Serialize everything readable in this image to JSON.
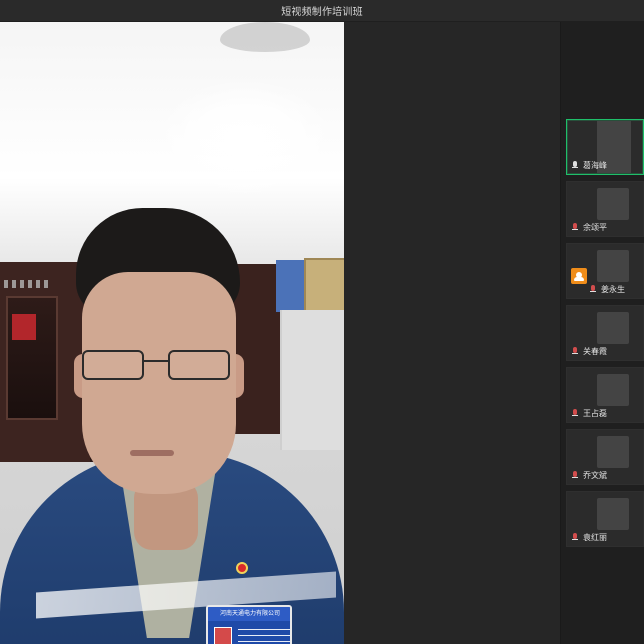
{
  "window": {
    "title": "短视频制作培训班"
  },
  "main_video": {
    "badge": {
      "company_text": "河南天通电力有限公司"
    }
  },
  "participants": [
    {
      "name": "葛海峰",
      "active": true,
      "avatar": "av-1",
      "host": false
    },
    {
      "name": "余颂平",
      "active": false,
      "avatar": "av-2",
      "host": false
    },
    {
      "name": "姜永生",
      "active": false,
      "avatar": "av-3",
      "host": true
    },
    {
      "name": "关春霞",
      "active": false,
      "avatar": "av-4",
      "host": false
    },
    {
      "name": "王占磊",
      "active": false,
      "avatar": "av-5",
      "host": false
    },
    {
      "name": "乔文斌",
      "active": false,
      "avatar": "av-6",
      "host": false
    },
    {
      "name": "袁红丽",
      "active": false,
      "avatar": "av-7",
      "host": false
    }
  ]
}
